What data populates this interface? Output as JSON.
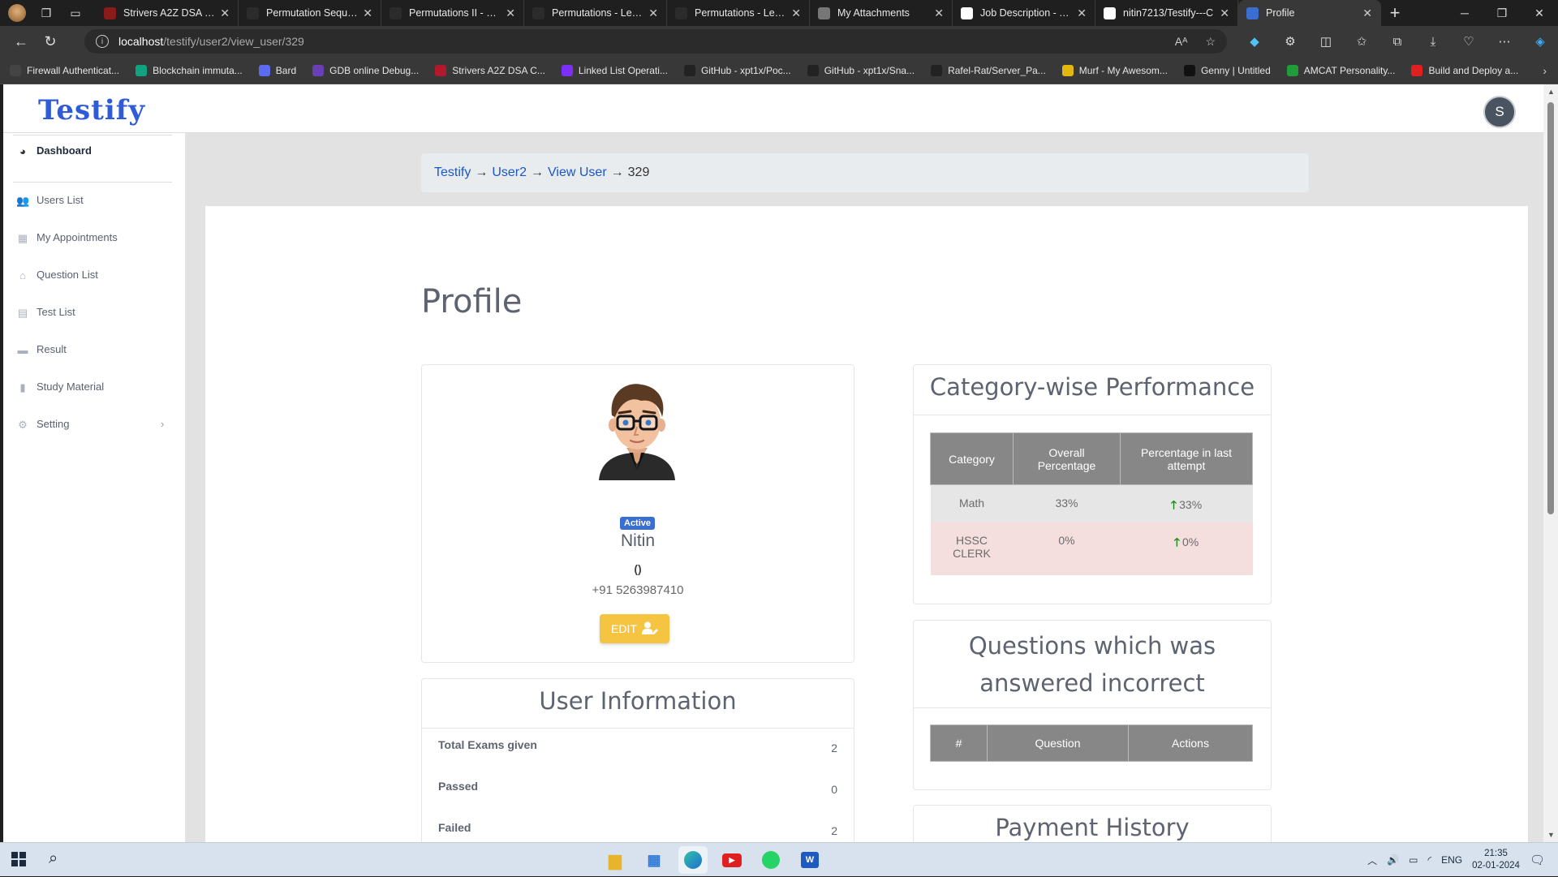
{
  "browser": {
    "tabs": [
      {
        "title": "Strivers A2Z DSA Co",
        "fav_color": "#8b1a1a",
        "fav_icon": "takeuforward-icon"
      },
      {
        "title": "Permutation Sequenc",
        "fav_color": "#2b2b2b",
        "fav_icon": "leetcode-icon"
      },
      {
        "title": "Permutations II - Lee",
        "fav_color": "#2b2b2b",
        "fav_icon": "leetcode-icon"
      },
      {
        "title": "Permutations - LeetC",
        "fav_color": "#2b2b2b",
        "fav_icon": "leetcode-icon"
      },
      {
        "title": "Permutations - LeetC",
        "fav_color": "#2b2b2b",
        "fav_icon": "leetcode-icon"
      },
      {
        "title": "My Attachments",
        "fav_color": "#777777",
        "fav_icon": "document-icon"
      },
      {
        "title": "Job Description - T-S",
        "fav_color": "#ffffff",
        "fav_icon": "document-icon"
      },
      {
        "title": "nitin7213/Testify---C",
        "fav_color": "#ffffff",
        "fav_icon": "github-icon"
      },
      {
        "title": "Profile",
        "fav_color": "#3b6ed1",
        "fav_icon": "testify-icon",
        "active": true
      }
    ],
    "url_host": "localhost",
    "url_path": "/testify/user2/view_user/329",
    "bookmarks": [
      {
        "label": "Firewall Authenticat...",
        "color": "#444444"
      },
      {
        "label": "Blockchain immuta...",
        "color": "#10a37f"
      },
      {
        "label": "Bard",
        "color": "#5b6cf0"
      },
      {
        "label": "GDB online Debug...",
        "color": "#6a3fb5"
      },
      {
        "label": "Strivers A2Z DSA C...",
        "color": "#b3182d"
      },
      {
        "label": "Linked List Operati...",
        "color": "#7b2ff7"
      },
      {
        "label": "GitHub - xpt1x/Poc...",
        "color": "#222222"
      },
      {
        "label": "GitHub - xpt1x/Sna...",
        "color": "#222222"
      },
      {
        "label": "Rafel-Rat/Server_Pa...",
        "color": "#222222"
      },
      {
        "label": "Murf - My Awesom...",
        "color": "#e3b70e"
      },
      {
        "label": "Genny | Untitled",
        "color": "#111111"
      },
      {
        "label": "AMCAT Personality...",
        "color": "#1f9d3a"
      },
      {
        "label": "Build and Deploy a...",
        "color": "#e02020"
      }
    ]
  },
  "app": {
    "logo": "Testify",
    "user_initial": "S",
    "sidebar": [
      {
        "label": "Dashboard",
        "icon": "dashboard-icon",
        "glyph": "◕"
      },
      {
        "label": "Users List",
        "icon": "users-icon",
        "glyph": "👥"
      },
      {
        "label": "My Appointments",
        "icon": "calendar-icon",
        "glyph": "▦"
      },
      {
        "label": "Question List",
        "icon": "bank-icon",
        "glyph": "⌂"
      },
      {
        "label": "Test List",
        "icon": "chalkboard-icon",
        "glyph": "▤"
      },
      {
        "label": "Result",
        "icon": "folder-icon",
        "glyph": "▬"
      },
      {
        "label": "Study Material",
        "icon": "book-icon",
        "glyph": "▮"
      },
      {
        "label": "Setting",
        "icon": "gear-icon",
        "glyph": "⚙"
      }
    ],
    "breadcrumb": {
      "c1": "Testify",
      "c2": "User2",
      "c3": "View User",
      "c4": "329",
      "sep": "→"
    },
    "page_title": "Profile",
    "profile": {
      "status": "Active",
      "name": "Nitin",
      "email": "()",
      "phone": "+91 5263987410",
      "edit_label": "EDIT"
    },
    "user_info": {
      "title": "User Information",
      "rows": [
        {
          "label": "Total Exams given",
          "value": "2"
        },
        {
          "label": "Passed",
          "value": "0"
        },
        {
          "label": "Failed",
          "value": "2"
        }
      ]
    },
    "category_perf": {
      "title": "Category-wise Performance",
      "headers": [
        "Category",
        "Overall Percentage",
        "Percentage in last attempt"
      ],
      "rows": [
        {
          "category": "Math",
          "overall": "33%",
          "last": "33%"
        },
        {
          "category": "HSSC CLERK",
          "overall": "0%",
          "last": "0%"
        }
      ]
    },
    "incorrect": {
      "title": "Questions which was answered incorrect",
      "headers": [
        "#",
        "Question",
        "Actions"
      ]
    },
    "payment": {
      "title": "Payment History"
    }
  },
  "taskbar": {
    "lang": "ENG",
    "time": "21:35",
    "date": "02-01-2024"
  }
}
